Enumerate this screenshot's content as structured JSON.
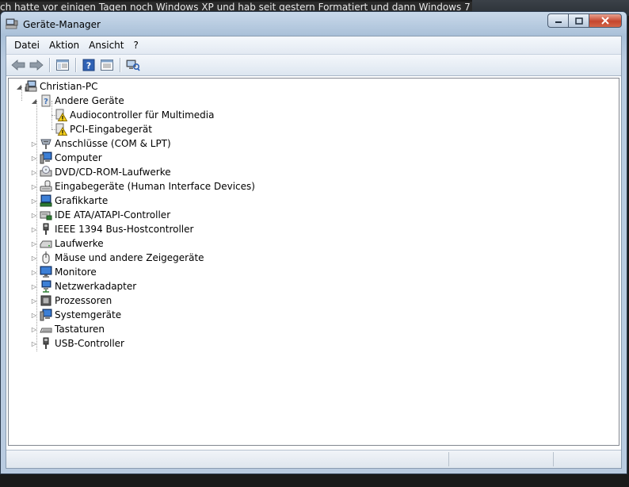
{
  "background_text": "ch hatte vor einigen Tagen noch Windows XP und hab seit gestern Formatiert und dann Windows 7",
  "window": {
    "title": "Geräte-Manager"
  },
  "menu": [
    "Datei",
    "Aktion",
    "Ansicht",
    "?"
  ],
  "toolbar": {
    "buttons": [
      {
        "icon": "back-arrow-icon"
      },
      {
        "icon": "forward-arrow-icon"
      },
      {
        "icon": "show-hide-console-tree-icon"
      },
      {
        "icon": "help-icon"
      },
      {
        "icon": "properties-icon"
      },
      {
        "icon": "scan-hardware-changes-icon"
      }
    ]
  },
  "tree": {
    "root": "Christian-PC",
    "other_devices": {
      "label": "Andere Geräte",
      "children": [
        "Audiocontroller für Multimedia",
        "PCI-Eingabegerät"
      ]
    },
    "categories": [
      {
        "label": "Anschlüsse (COM & LPT)",
        "icon": "port-icon"
      },
      {
        "label": "Computer",
        "icon": "computer-icon"
      },
      {
        "label": "DVD/CD-ROM-Laufwerke",
        "icon": "dvd-drive-icon"
      },
      {
        "label": "Eingabegeräte (Human Interface Devices)",
        "icon": "hid-icon"
      },
      {
        "label": "Grafikkarte",
        "icon": "display-adapter-icon"
      },
      {
        "label": "IDE ATA/ATAPI-Controller",
        "icon": "ide-controller-icon"
      },
      {
        "label": "IEEE 1394 Bus-Hostcontroller",
        "icon": "firewire-icon"
      },
      {
        "label": "Laufwerke",
        "icon": "disk-drive-icon"
      },
      {
        "label": "Mäuse und andere Zeigegeräte",
        "icon": "mouse-icon"
      },
      {
        "label": "Monitore",
        "icon": "monitor-icon"
      },
      {
        "label": "Netzwerkadapter",
        "icon": "network-adapter-icon"
      },
      {
        "label": "Prozessoren",
        "icon": "processor-icon"
      },
      {
        "label": "Systemgeräte",
        "icon": "system-device-icon"
      },
      {
        "label": "Tastaturen",
        "icon": "keyboard-icon"
      },
      {
        "label": "USB-Controller",
        "icon": "usb-icon"
      }
    ]
  }
}
